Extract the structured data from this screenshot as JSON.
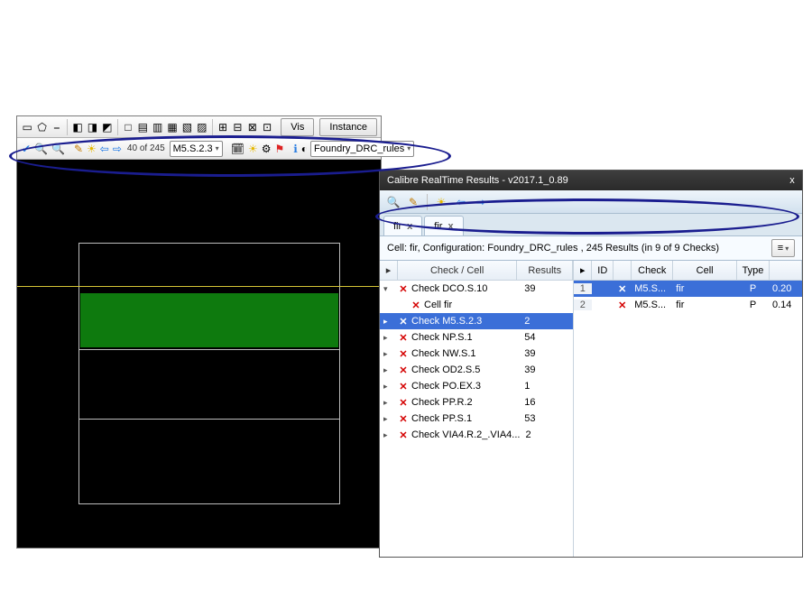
{
  "editor": {
    "toolbar1": {
      "vis_btn": "Vis",
      "instance_tab": "Instance"
    },
    "toolbar2": {
      "counter": "40 of 245",
      "rule_combo": "M5.S.2.3",
      "config_combo": "Foundry_DRC_rules"
    }
  },
  "results": {
    "title": "Calibre RealTime Results - v2017.1_0.89",
    "close_glyph": "x",
    "tabs": [
      {
        "label": "fir",
        "close": "x"
      },
      {
        "label": "fir",
        "close": "x"
      }
    ],
    "summary": "Cell: fir, Configuration: Foundry_DRC_rules , 245 Results (in 9 of 9 Checks)",
    "options_glyph": "≡",
    "check_headers": {
      "col1": "Check / Cell",
      "col2": "Results"
    },
    "checks": [
      {
        "tri": "▾",
        "indent": 0,
        "name": "Check DCO.S.10",
        "count": "39",
        "sel": false
      },
      {
        "tri": "",
        "indent": 1,
        "name": "Cell fir",
        "count": "",
        "sel": false
      },
      {
        "tri": "▸",
        "indent": 0,
        "name": "Check M5.S.2.3",
        "count": "2",
        "sel": true
      },
      {
        "tri": "▸",
        "indent": 0,
        "name": "Check NP.S.1",
        "count": "54",
        "sel": false
      },
      {
        "tri": "▸",
        "indent": 0,
        "name": "Check NW.S.1",
        "count": "39",
        "sel": false
      },
      {
        "tri": "▸",
        "indent": 0,
        "name": "Check OD2.S.5",
        "count": "39",
        "sel": false
      },
      {
        "tri": "▸",
        "indent": 0,
        "name": "Check PO.EX.3",
        "count": "1",
        "sel": false
      },
      {
        "tri": "▸",
        "indent": 0,
        "name": "Check PP.R.2",
        "count": "16",
        "sel": false
      },
      {
        "tri": "▸",
        "indent": 0,
        "name": "Check PP.S.1",
        "count": "53",
        "sel": false
      },
      {
        "tri": "▸",
        "indent": 0,
        "name": "Check VIA4.R.2_.VIA4...",
        "count": "2",
        "sel": false
      }
    ],
    "detail_headers": {
      "id": "ID",
      "check": "Check",
      "cell": "Cell",
      "type": "Type",
      "val": ""
    },
    "details": [
      {
        "row": "1",
        "check": "M5.S...",
        "cell": "fir",
        "type": "P",
        "val": "0.20",
        "sel": true
      },
      {
        "row": "2",
        "check": "M5.S...",
        "cell": "fir",
        "type": "P",
        "val": "0.14",
        "sel": false
      }
    ]
  }
}
